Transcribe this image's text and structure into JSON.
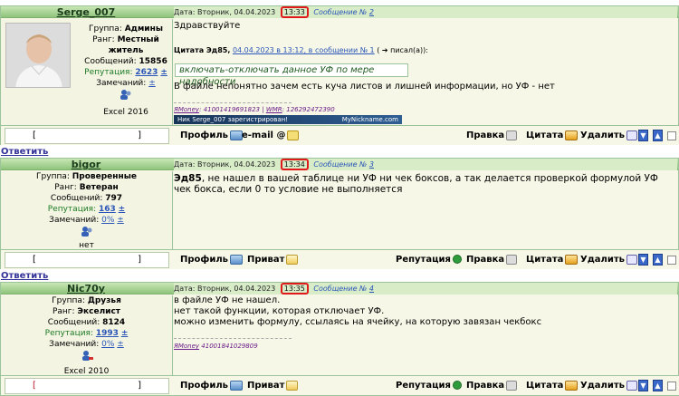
{
  "reply_label": "Ответить",
  "posts": [
    {
      "author": "Serge_007",
      "group_label": "Группа:",
      "group": "Админы",
      "rank_label": "Ранг:",
      "rank": "Местный житель",
      "posts_label": "Сообщений:",
      "posts_count": "15856",
      "rep_label": "Репутация:",
      "rep_value": "2623",
      "rep_plus": "±",
      "warn_label": "Замечаний:",
      "warn_value": "±",
      "extra": "Excel 2016",
      "date": "Дата: Вторник, 04.04.2023",
      "time": "13:33",
      "msg": "Сообщение №",
      "msg_no": "2",
      "body": "Здравствуйте",
      "quote_header_a": "Цитата Эд85,",
      "quote_link": "04.04.2023 в 13:12, в сообщении № 1",
      "quote_header_b": "( ➔ писал(а)):",
      "quote_text": "включать-отключать данное УФ по мере надобности",
      "body2": "В файле непонятно зачем есть куча листов и лишней информации, но УФ - нет",
      "sig_a": "ЯMoney",
      "sig_a_val": ": 41001419691823",
      "sig_sep": " | ",
      "sig_b": "WMR",
      "sig_b_val": ": 126292472390",
      "nickbar_left": "Ник Serge_007 зарегистрирован!",
      "nickbar_right": "MyNickname.com",
      "ip_open": "[",
      "ip_close": "]",
      "btn_profile": "Профиль",
      "btn_email": "e-mail",
      "btn_edit": "Правка",
      "btn_quote": "Цитата",
      "btn_delete": "Удалить"
    },
    {
      "author": "bigor",
      "group_label": "Группа:",
      "group": "Проверенные",
      "rank_label": "Ранг:",
      "rank": "Ветеран",
      "posts_label": "Сообщений:",
      "posts_count": "797",
      "rep_label": "Репутация:",
      "rep_value": "163",
      "rep_plus": "±",
      "warn_label": "Замечаний:",
      "warn_value": "0%",
      "warn_plus": "±",
      "extra": "нет",
      "date": "Дата: Вторник, 04.04.2023",
      "time": "13:34",
      "msg": "Сообщение №",
      "msg_no": "3",
      "body_bold": "Эд85",
      "body": ", не нашел в вашей таблице ни УФ ни чек боксов, а так делается проверкой формулой УФ чек бокса, если 0 то условие не выполняется",
      "ip_open": "[",
      "ip_close": "]",
      "btn_profile": "Профиль",
      "btn_pm": "Приват",
      "btn_rep": "Репутация",
      "btn_edit": "Правка",
      "btn_quote": "Цитата",
      "btn_delete": "Удалить"
    },
    {
      "author": "Nic70y",
      "group_label": "Группа:",
      "group": "Друзья",
      "rank_label": "Ранг:",
      "rank": "Экселист",
      "posts_label": "Сообщений:",
      "posts_count": "8124",
      "rep_label": "Репутация:",
      "rep_value": "1993",
      "rep_plus": "±",
      "warn_label": "Замечаний:",
      "warn_value": "0%",
      "warn_plus": "±",
      "extra": "Excel 2010",
      "date": "Дата: Вторник, 04.04.2023",
      "time": "13:35",
      "msg": "Сообщение №",
      "msg_no": "4",
      "body_lines": [
        "в файле УФ не нашел.",
        "нет такой функции, которая отключает УФ.",
        "можно изменить формулу, ссылаясь на ячейку, на которую завязан чекбокс"
      ],
      "sig_a": "ЯMoney",
      "sig_a_val": " 41001841029809",
      "ip_open": "[",
      "ip_close": "]",
      "btn_profile": "Профиль",
      "btn_pm": "Приват",
      "btn_rep": "Репутация",
      "btn_edit": "Правка",
      "btn_quote": "Цитата",
      "btn_delete": "Удалить"
    }
  ]
}
